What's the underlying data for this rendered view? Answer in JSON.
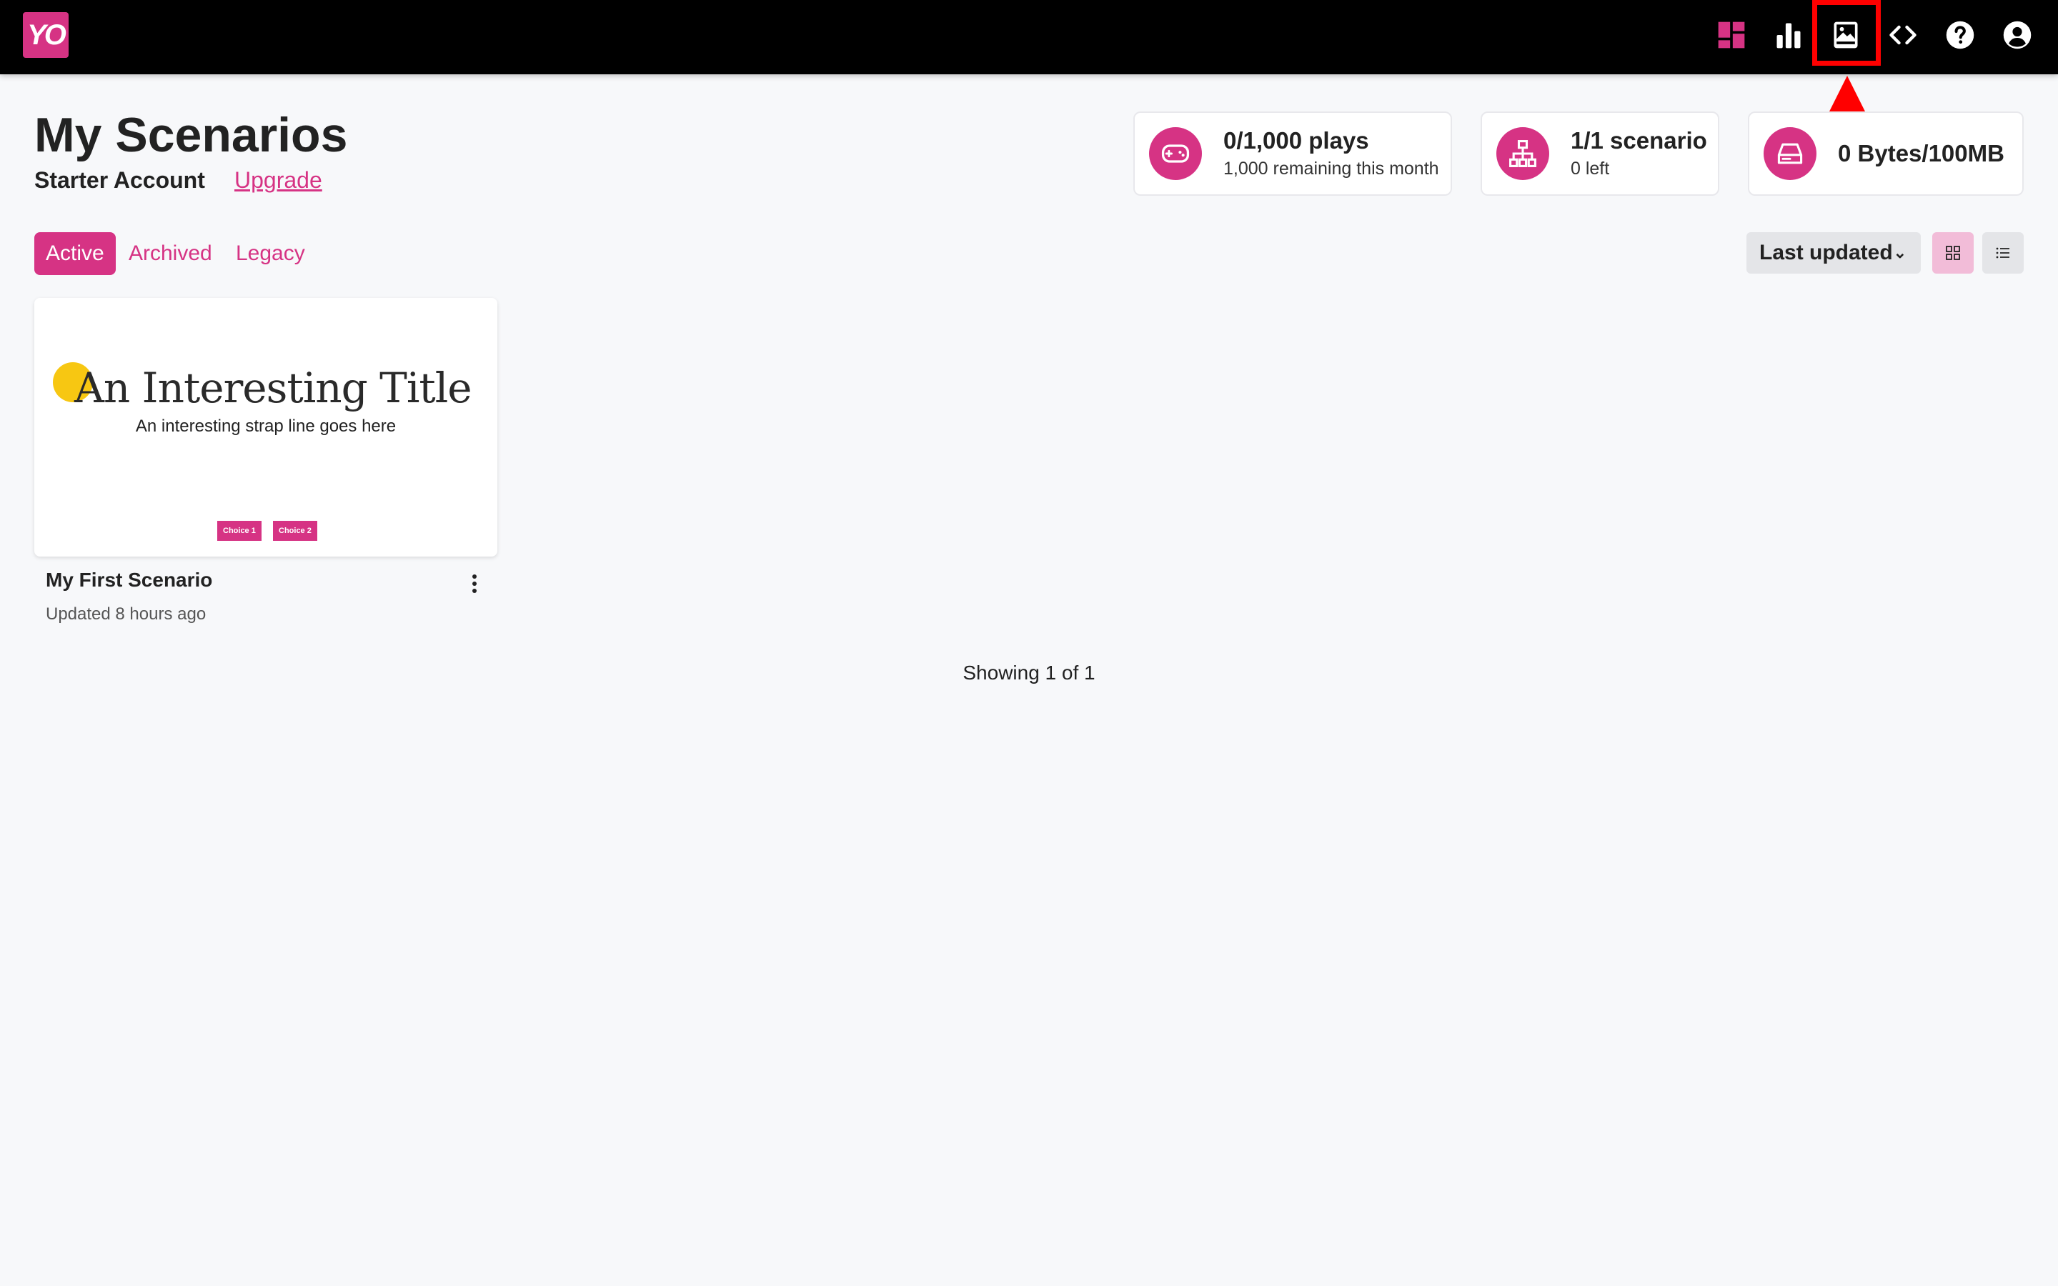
{
  "app": {
    "logo_text": "YO",
    "brand_color": "#d63384"
  },
  "topnav": {
    "icons": [
      "dashboard-icon",
      "analytics-icon",
      "media-library-icon",
      "embed-code-icon",
      "help-icon",
      "account-icon"
    ],
    "highlighted": "media-library-icon"
  },
  "header": {
    "title": "My Scenarios",
    "account_type": "Starter Account",
    "upgrade_label": "Upgrade"
  },
  "stats": {
    "plays": {
      "main": "0/1,000 plays",
      "sub": "1,000 remaining this month",
      "icon": "gamepad-icon"
    },
    "scenarios": {
      "main": "1/1 scenario",
      "sub": "0 left",
      "icon": "sitemap-icon"
    },
    "storage": {
      "main": "0 Bytes/100MB",
      "icon": "hard-drive-icon"
    }
  },
  "tabs": [
    {
      "label": "Active",
      "active": true
    },
    {
      "label": "Archived",
      "active": false
    },
    {
      "label": "Legacy",
      "active": false
    }
  ],
  "sort": {
    "selected": "Last updated"
  },
  "view_modes": {
    "active": "grid"
  },
  "scenarios": [
    {
      "name": "My First Scenario",
      "updated": "Updated 8 hours ago",
      "thumbnail": {
        "title": "An Interesting Title",
        "strap": "An interesting strap line goes here",
        "choices": [
          "Choice 1",
          "Choice 2"
        ]
      }
    }
  ],
  "pagination": {
    "text": "Showing 1 of 1"
  }
}
